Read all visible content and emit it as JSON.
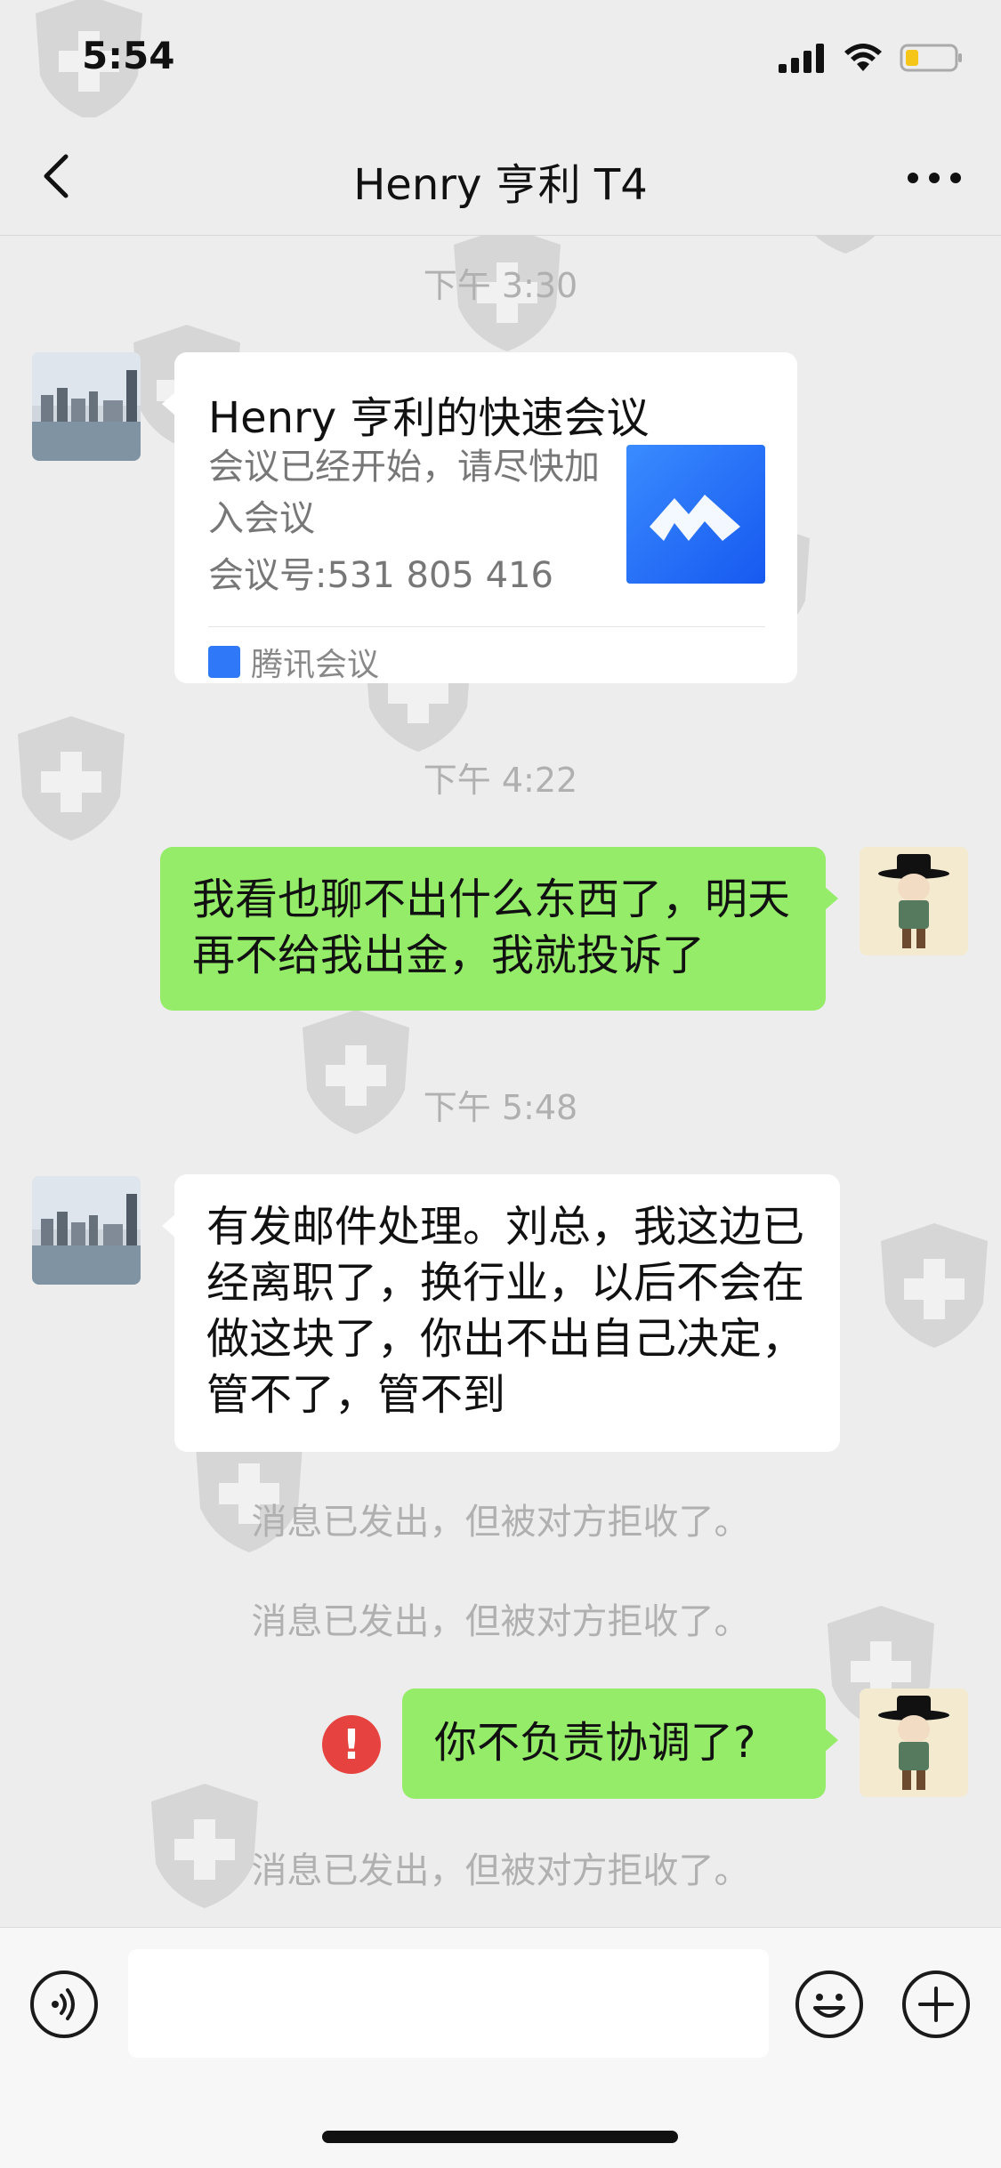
{
  "status": {
    "time": "5:54"
  },
  "header": {
    "title": "Henry 亨利 T4"
  },
  "messages": {
    "ts1": "下午 3:30",
    "card": {
      "title": "Henry 亨利的快速会议",
      "desc": "会议已经开始，请尽快加入会议",
      "number": "会议号:531 805 416",
      "source": "腾讯会议"
    },
    "ts2": "下午 4:22",
    "msg1": "我看也聊不出什么东西了，明天再不给我出金，我就投诉了",
    "ts3": "下午 5:48",
    "msg2": "有发邮件处理。刘总，我这边已经离职了，换行业，以后不会在做这块了，你出不出自己决定，管不了，管不到",
    "sys1": "消息已发出，但被对方拒收了。",
    "sys2": "消息已发出，但被对方拒收了。",
    "msg3": "你不负责协调了?",
    "warn": "!",
    "sys3": "消息已发出，但被对方拒收了。"
  },
  "colors": {
    "bubble_green": "#95ec69",
    "warning_red": "#e64340",
    "card_logo_blue": "#2f78f7"
  }
}
